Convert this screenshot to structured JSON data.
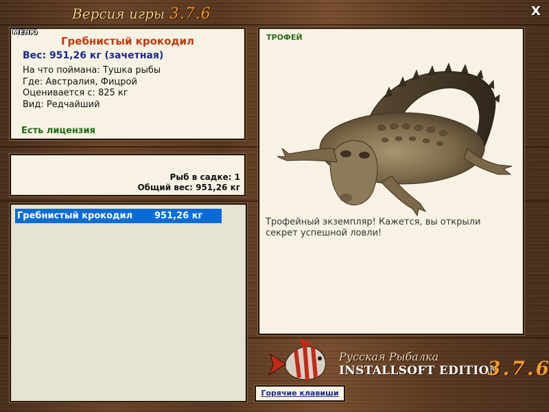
{
  "window": {
    "title_prefix": "Версия игры",
    "version": "3.7.6",
    "close_label": "X"
  },
  "catch": {
    "fish_name": "Гребнистый крокодил",
    "weight": "Вес: 951,26 кг (зачетная)",
    "lines": [
      "На что поймана: Тушка рыбы",
      "Где: Австралия, Фицрой",
      "Оценивается с: 825 кг",
      "Вид: Редчайший"
    ],
    "license": "Есть лицензия"
  },
  "stats": {
    "count": "Рыб в садке: 1",
    "total": "Общий вес: 951,26 кг",
    "menu_label": "МЕНЮ"
  },
  "list": {
    "rows": [
      {
        "name": "Гребнистый крокодил",
        "weight": "951,26 кг"
      }
    ]
  },
  "trophy": {
    "label": "ТРОФЕЙ",
    "text": "Трофейный экземпляр! Кажется, вы открыли секрет успешной ловли!"
  },
  "logo": {
    "line1": "Русская Рыбалка",
    "line2": "INSTALLSOFT EDITION",
    "version": "3.7.6"
  },
  "hotkeys_label": "Горячие клавиши",
  "colors": {
    "accent_orange": "#f39a2a",
    "fish_name_red": "#c0390f",
    "weight_blue": "#1a2a8a",
    "license_green": "#1c6a10",
    "selection_blue": "#0a6bd6"
  }
}
